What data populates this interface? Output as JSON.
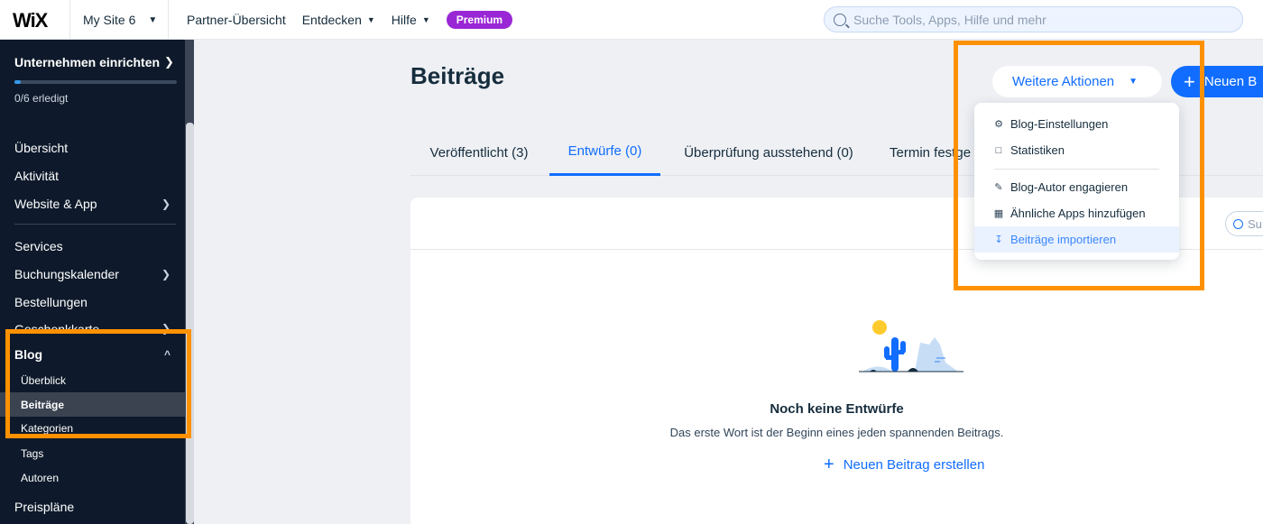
{
  "topbar": {
    "logo": "WiX",
    "site_name": "My Site 6",
    "nav": [
      {
        "label": "Partner-Übersicht"
      },
      {
        "label": "Entdecken"
      },
      {
        "label": "Hilfe"
      }
    ],
    "premium_badge": "Premium",
    "search_placeholder": "Suche Tools, Apps, Hilfe und mehr"
  },
  "sidebar": {
    "setup_title": "Unternehmen einrichten",
    "setup_progress_text": "0/6 erledigt",
    "setup_progress_fraction": 0.04,
    "group1": [
      "Übersicht",
      "Aktivität",
      "Website & App"
    ],
    "group2": [
      "Services",
      "Buchungskalender",
      "Bestellungen",
      "Geschenkkarte"
    ],
    "blog": {
      "label": "Blog",
      "items": [
        "Überblick",
        "Beiträge",
        "Kategorien",
        "Tags",
        "Autoren"
      ]
    },
    "pricing": "Preispläne"
  },
  "main": {
    "title": "Beiträge",
    "more_actions": "Weitere Aktionen",
    "new_post": "Neuen B",
    "tabs": [
      {
        "label": "Veröffentlicht (3)"
      },
      {
        "label": "Entwürfe (0)"
      },
      {
        "label": "Überprüfung ausstehend (0)"
      },
      {
        "label": "Termin festge"
      }
    ],
    "card_search_placeholder": "Su",
    "empty_title": "Noch keine Entwürfe",
    "empty_subtitle": "Das erste Wort ist der Beginn eines jeden spannenden Beitrags.",
    "create_link": "Neuen Beitrag erstellen"
  },
  "dropdown": {
    "items": [
      {
        "label": "Blog-Einstellungen",
        "icon": "gear-icon"
      },
      {
        "label": "Statistiken",
        "icon": "bar-chart-icon"
      },
      {
        "label": "Blog-Autor engagieren",
        "icon": "pen-nib-icon"
      },
      {
        "label": "Ähnliche Apps hinzufügen",
        "icon": "apps-grid-icon"
      },
      {
        "label": "Beiträge importieren",
        "icon": "download-icon"
      }
    ]
  },
  "colors": {
    "accent": "#116dff",
    "highlight": "#ff9100",
    "sidebar": "#0e1a2b",
    "premium": "#9a27d5"
  }
}
